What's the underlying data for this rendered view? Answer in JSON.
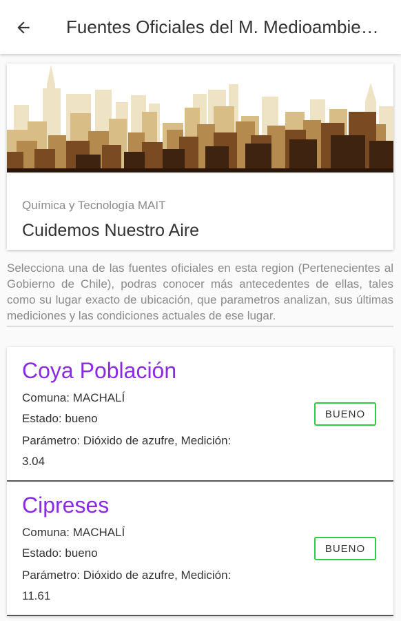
{
  "appbar": {
    "title": "Fuentes Oficiales del M. Medioambiente",
    "back_icon": "arrow-back-icon"
  },
  "header_card": {
    "image": "city-skyline",
    "subtitle": "Química y Tecnología MAIT",
    "title": "Cuidemos Nuestro Aire"
  },
  "description": "Selecciona una de las fuentes oficiales en esta region (Pertenecientes al Gobierno de Chile), podras conocer más antecedentes de ellas, tales como su lugar exacto de ubicación, que parametros analizan, sus últimas mediciones y las condiciones actuales de ese lugar.",
  "colors": {
    "station_name": "#8a2be2",
    "status_border": "#2ecc40"
  },
  "stations": [
    {
      "name": "Coya Población",
      "comuna": "Comuna: MACHALÍ",
      "estado": "Estado: bueno",
      "parametro": "Parámetro: Dióxido de azufre, Medición:",
      "medicion": "3.04",
      "status_label": "BUENO"
    },
    {
      "name": "Cipreses",
      "comuna": "Comuna: MACHALÍ",
      "estado": "Estado: bueno",
      "parametro": "Parámetro: Dióxido de azufre, Medición:",
      "medicion": "11.61",
      "status_label": "BUENO"
    }
  ]
}
